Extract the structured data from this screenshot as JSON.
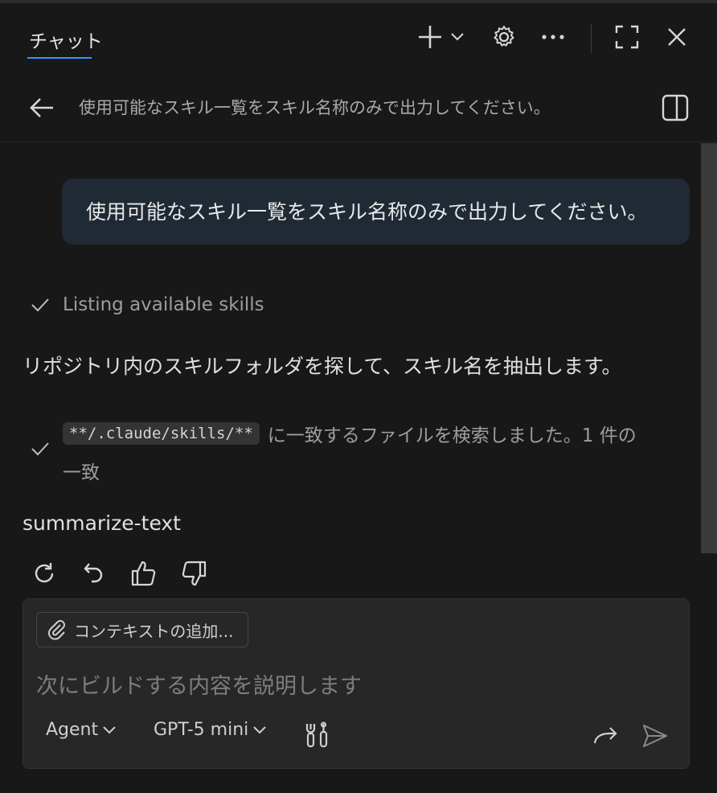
{
  "header": {
    "tab_title": "チャット",
    "icons": [
      "plus-icon",
      "chevron-down-icon",
      "gear-icon",
      "ellipsis-icon",
      "maximize-icon",
      "close-icon"
    ]
  },
  "titlebar": {
    "title": "使用可能なスキル一覧をスキル名称のみで出力してください。",
    "icons": [
      "back-arrow-icon",
      "panel-toggle-icon"
    ]
  },
  "conversation": {
    "user_message": "使用可能なスキル一覧をスキル名称のみで出力してください。",
    "status_step": "Listing available skills",
    "response_text": "リポジトリ内のスキルフォルダを探して、スキル名を抽出します。",
    "search_pattern": "**/.claude/skills/**",
    "search_result_line1": "に一致するファイルを検索しました。1 件の",
    "search_result_line2": "一致",
    "skill_name": "summarize-text",
    "action_icons": [
      "retry-icon",
      "undo-icon",
      "thumbs-up-icon",
      "thumbs-down-icon"
    ]
  },
  "input": {
    "add_context_label": "コンテキストの追加...",
    "placeholder": "次にビルドする内容を説明します",
    "mode_label": "Agent",
    "model_label": "GPT-5 mini"
  },
  "colors": {
    "background": "#181818",
    "user_bubble": "#1f2a35",
    "accent": "#3794ff",
    "input_background": "#272727"
  }
}
